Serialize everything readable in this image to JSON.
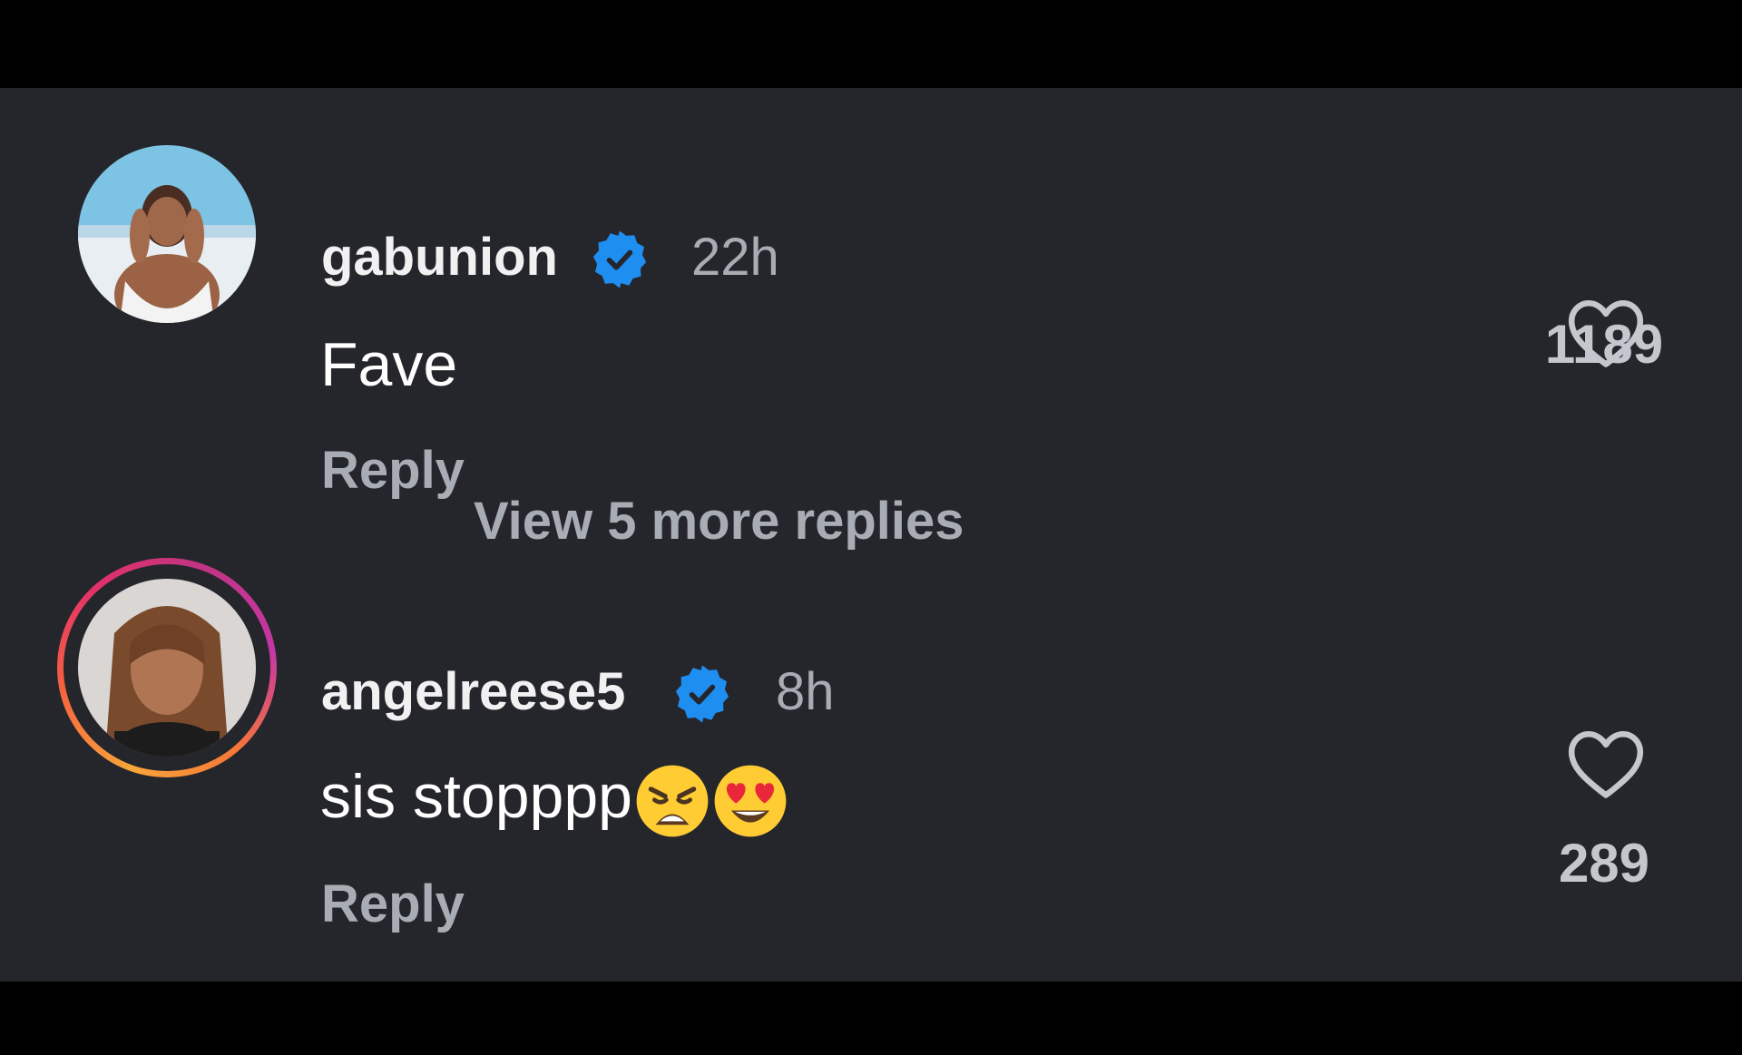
{
  "comments": [
    {
      "username": "gabunion",
      "verified_icon": "verified-badge-icon",
      "time": "22h",
      "text": "Fave",
      "emojis": [],
      "reply_label": "Reply",
      "like_icon": "heart-outline-icon",
      "like_count": "1189",
      "has_story_ring": false
    },
    {
      "username": "angelreese5",
      "verified_icon": "verified-badge-icon",
      "time": "8h",
      "text": "sis stopppp",
      "emojis": [
        "weary-face-emoji",
        "heart-eyes-emoji"
      ],
      "reply_label": "Reply",
      "like_icon": "heart-outline-icon",
      "like_count": "289",
      "has_story_ring": true
    }
  ],
  "view_more_replies": "View 5 more replies",
  "colors": {
    "background": "#25262b",
    "letterbox": "#000000",
    "verified_badge": "#1f8ef1",
    "primary_text": "#f1f1f1",
    "secondary_text": "#a8acb5"
  }
}
